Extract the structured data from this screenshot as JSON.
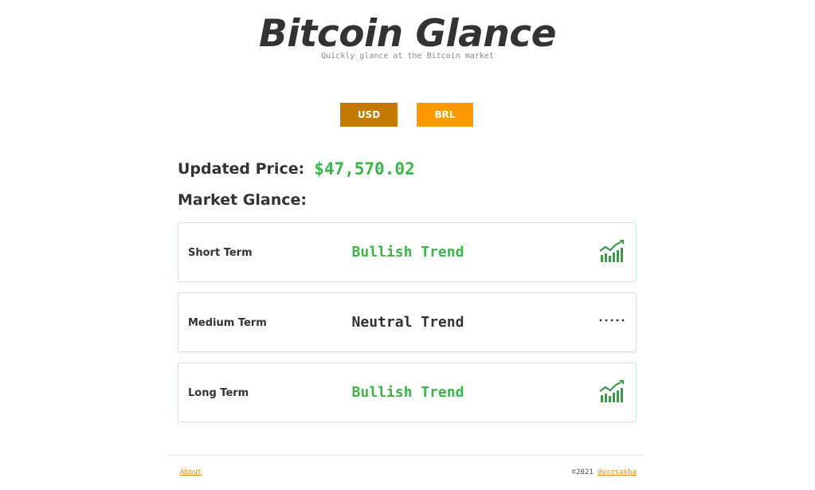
{
  "header": {
    "title": "Bitcoin Glance",
    "subtitle": "Quickly glance at the Bitcoin market"
  },
  "currencies": [
    {
      "label": "USD",
      "color": "#c47a00",
      "selected": true
    },
    {
      "label": "BRL",
      "color": "#ff9900",
      "selected": false
    }
  ],
  "price": {
    "label": "Updated Price:",
    "value": "$47,570.02",
    "color": "#3bb54a"
  },
  "market": {
    "label": "Market Glance:",
    "cards": [
      {
        "term": "Short Term",
        "trend": "Bullish Trend",
        "icon": "trending-up-chart-icon"
      },
      {
        "term": "Medium Term",
        "trend": "Neutral Trend",
        "icon": "dotted-line-icon"
      },
      {
        "term": "Long Term",
        "trend": "Bullish Trend",
        "icon": "trending-up-chart-icon"
      }
    ]
  },
  "footer": {
    "about": "About",
    "copyright": "©2021",
    "author": "@vorsakha"
  }
}
